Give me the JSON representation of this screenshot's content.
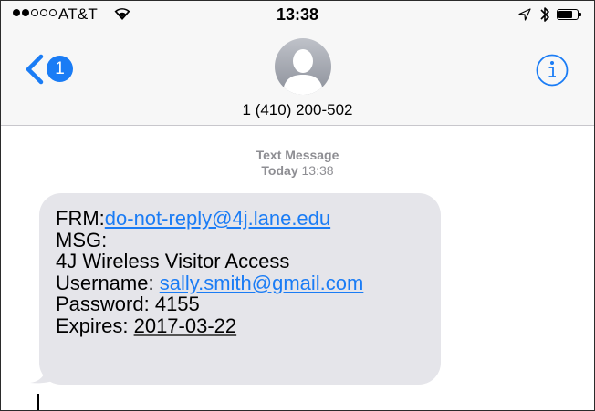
{
  "status_bar": {
    "carrier": "AT&T",
    "time": "13:38",
    "signal_bars_filled": 2,
    "signal_bars_total": 5,
    "icons": [
      "wifi-icon",
      "location-arrow-icon",
      "bluetooth-icon",
      "battery-icon"
    ],
    "battery_level": 0.75
  },
  "nav": {
    "back_badge": "1",
    "contact_name": "1 (410) 200-502",
    "icons": [
      "chevron-left-icon",
      "contact-avatar-icon",
      "info-icon"
    ]
  },
  "thread": {
    "service_label": "Text Message",
    "day_label": "Today",
    "time_label": "13:38"
  },
  "message": {
    "from_label": "FRM:",
    "from_email": "do-not-reply@4j.lane.edu",
    "msg_label": "MSG:",
    "line_title": "4J Wireless Visitor Access",
    "username_label": "Username: ",
    "username_value": "sally.smith@gmail.com",
    "password_label": "Password: ",
    "password_value": "4155",
    "expires_label": "Expires: ",
    "expires_value": "2017-03-22"
  },
  "colors": {
    "accent": "#1a7cf5",
    "bubble": "#e5e5ea",
    "secondary_text": "#8e8e93",
    "bar_background": "#f7f7f7"
  }
}
